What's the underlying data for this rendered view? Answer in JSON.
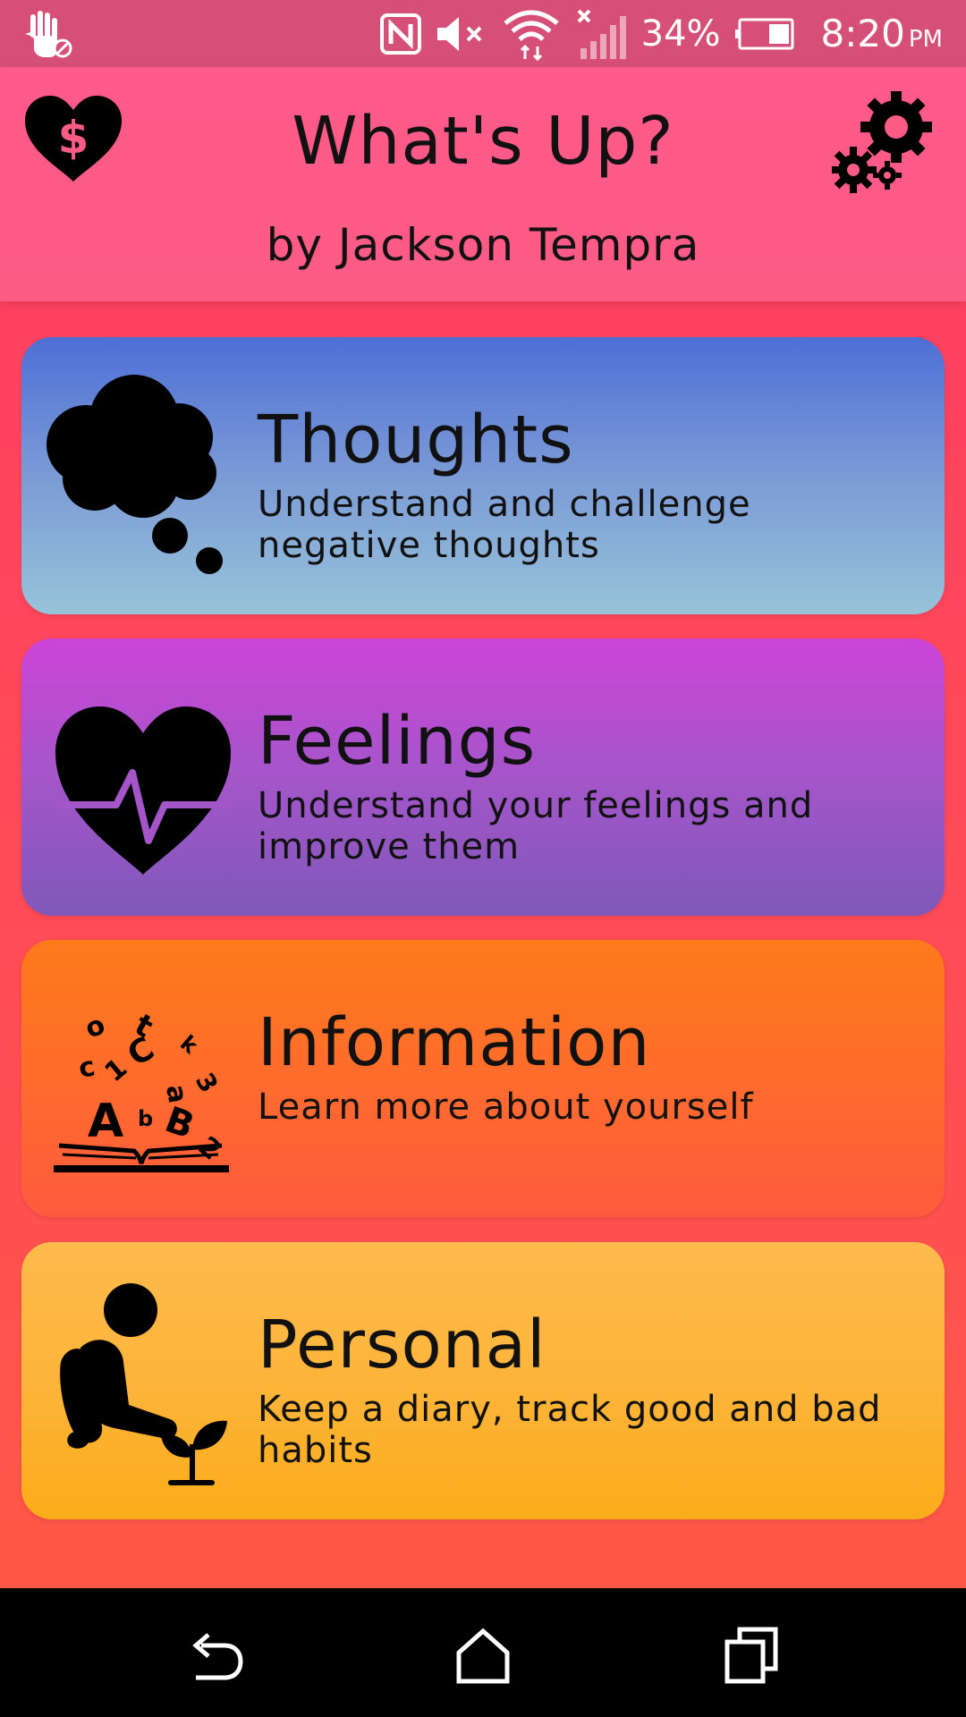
{
  "status_bar": {
    "battery_percent": "34%",
    "time": "8:20",
    "ampm": "PM",
    "icons": [
      "do-not-disturb-hand-icon",
      "nfc-icon",
      "volume-muted-icon",
      "wifi-icon",
      "no-signal-icon",
      "battery-icon"
    ]
  },
  "header": {
    "title": "What's Up?",
    "subtitle": "by Jackson Tempra",
    "left_icon": "donate-heart-icon",
    "right_icon": "settings-gears-icon"
  },
  "cards": [
    {
      "title": "Thoughts",
      "description": "Understand and challenge negative thoughts",
      "icon": "thought-cloud-icon"
    },
    {
      "title": "Feelings",
      "description": "Understand your feelings and improve them",
      "icon": "heartbeat-icon"
    },
    {
      "title": "Information",
      "description": "Learn more about yourself",
      "icon": "book-letters-icon"
    },
    {
      "title": "Personal",
      "description": "Keep a diary, track good and bad habits",
      "icon": "person-plant-icon"
    }
  ],
  "nav_bar": {
    "icons": [
      "back-icon",
      "home-icon",
      "recents-icon"
    ]
  },
  "colors": {
    "status_bar": "#d64f78",
    "header": "#fc5b84",
    "background": "#ff4a58",
    "thoughts_card": "#7896d6",
    "feelings_card": "#a456c9",
    "information_card": "#ff6a2e",
    "personal_card": "#fdb43a"
  }
}
